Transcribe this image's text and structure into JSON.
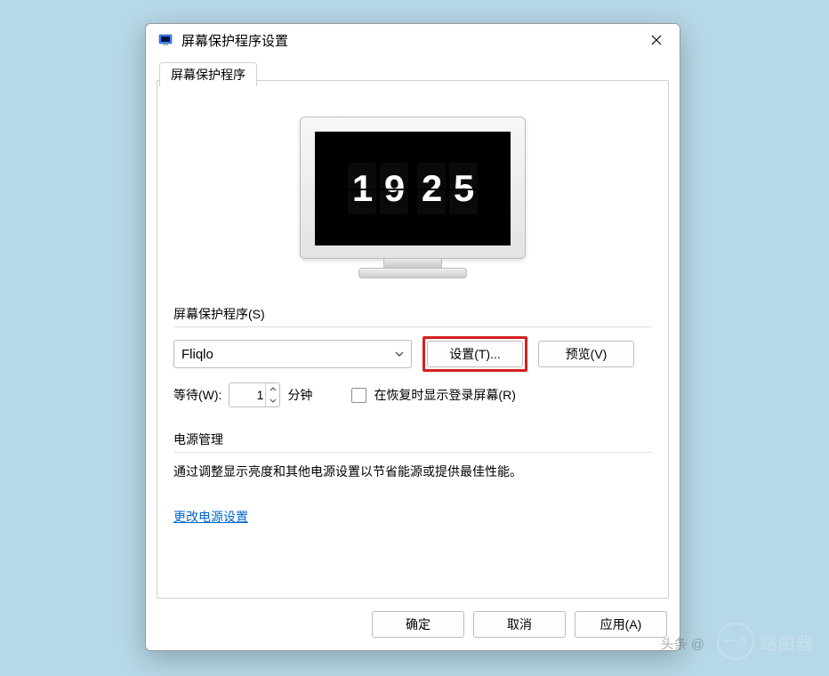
{
  "window": {
    "title": "屏幕保护程序设置"
  },
  "tab": {
    "label": "屏幕保护程序"
  },
  "preview_clock": {
    "h1": "1",
    "h2": "9",
    "m1": "2",
    "m2": "5"
  },
  "screensaver": {
    "group_label": "屏幕保护程序(S)",
    "selected": "Fliqlo",
    "settings_button": "设置(T)...",
    "preview_button": "预览(V)",
    "wait_label": "等待(W):",
    "wait_value": "1",
    "minutes_label": "分钟",
    "resume_checkbox_label": "在恢复时显示登录屏幕(R)"
  },
  "power": {
    "group_label": "电源管理",
    "description": "通过调整显示亮度和其他电源设置以节省能源或提供最佳性能。",
    "link": "更改电源设置"
  },
  "buttons": {
    "ok": "确定",
    "cancel": "取消",
    "apply": "应用(A)"
  },
  "footer": {
    "attribution": "头条 @",
    "watermark_text": "路由器"
  }
}
